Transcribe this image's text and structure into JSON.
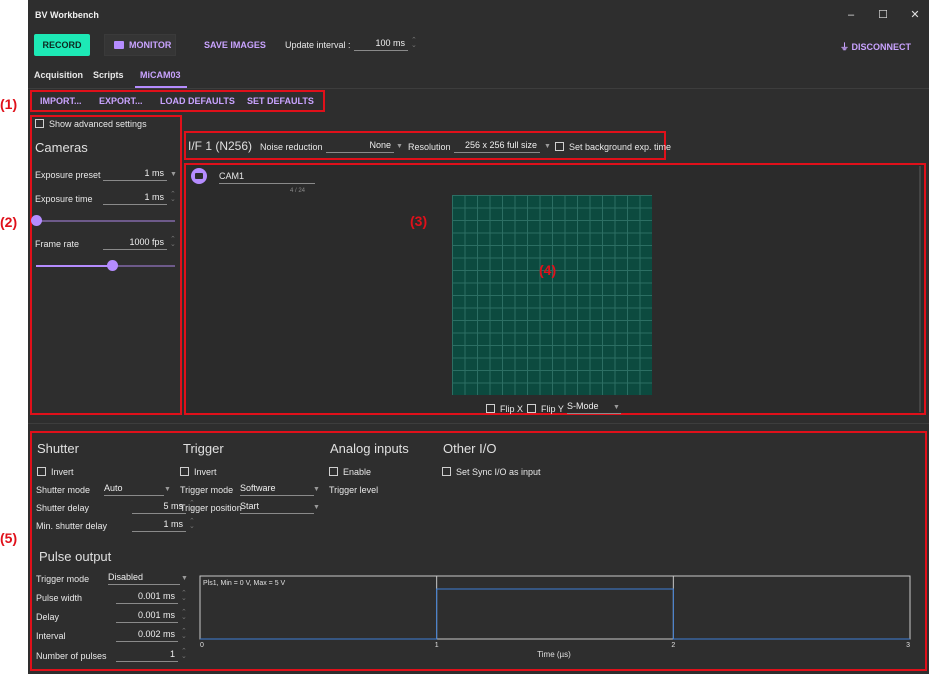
{
  "callouts": [
    "(1)",
    "(2)",
    "(3)",
    "(4)",
    "(5)"
  ],
  "title": "BV Workbench",
  "window_controls": {
    "minimize": "‒",
    "maximize": "☐",
    "close": "✕"
  },
  "toolbar": {
    "record": "RECORD",
    "monitor": "MONITOR",
    "save_images": "SAVE IMAGES",
    "update_interval_label": "Update interval :",
    "update_interval_value": "100 ms",
    "disconnect": "DISCONNECT"
  },
  "tabs": [
    "Acquisition",
    "Scripts",
    "MiCAM03"
  ],
  "actions": [
    "IMPORT...",
    "EXPORT...",
    "LOAD DEFAULTS",
    "SET DEFAULTS"
  ],
  "left": {
    "advanced": "Show advanced settings",
    "cameras_title": "Cameras",
    "exposure_preset_label": "Exposure preset",
    "exposure_preset_value": "1 ms",
    "exposure_time_label": "Exposure time",
    "exposure_time_value": "1 ms",
    "exposure_slider": 0.0,
    "frame_rate_label": "Frame rate",
    "frame_rate_value": "1000 fps",
    "frame_rate_slider": 0.55
  },
  "interface": {
    "title": "I/F 1 (N256)",
    "noise_label": "Noise reduction",
    "noise_value": "None",
    "resolution_label": "Resolution",
    "resolution_value": "256 x 256 full size",
    "bg_exp": "Set background exp. time"
  },
  "camera": {
    "name": "CAM1",
    "counter": "4 / 24",
    "flip_x": "Flip X",
    "flip_y": "Flip Y",
    "mode": "S-Mode"
  },
  "shutter": {
    "title": "Shutter",
    "invert": "Invert",
    "mode_label": "Shutter mode",
    "mode_value": "Auto",
    "delay_label": "Shutter delay",
    "delay_value": "5 ms",
    "min_label": "Min. shutter delay",
    "min_value": "1 ms"
  },
  "trigger": {
    "title": "Trigger",
    "invert": "Invert",
    "mode_label": "Trigger mode",
    "mode_value": "Software",
    "position_label": "Trigger position",
    "position_value": "Start"
  },
  "analog": {
    "title": "Analog inputs",
    "enable": "Enable",
    "level_label": "Trigger level"
  },
  "other_io": {
    "title": "Other I/O",
    "sync": "Set Sync I/O as input"
  },
  "pulse": {
    "title": "Pulse output",
    "trigger_label": "Trigger mode",
    "trigger_value": "Disabled",
    "width_label": "Pulse width",
    "width_value": "0.001 ms",
    "delay_label": "Delay",
    "delay_value": "0.001 ms",
    "interval_label": "Interval",
    "interval_value": "0.002 ms",
    "count_label": "Number of pulses",
    "count_value": "1"
  },
  "chart_data": {
    "type": "line",
    "legend": "Pls1, Min = 0 V, Max = 5 V",
    "xlabel": "Time (µs)",
    "ylabel": "",
    "xlim": [
      0,
      3
    ],
    "ylim": [
      0,
      5
    ],
    "xticks": [
      "0",
      "1",
      "2",
      "3"
    ],
    "series": [
      {
        "name": "Pls1",
        "x": [
          0,
          1,
          1,
          2,
          2,
          3
        ],
        "y": [
          0,
          0,
          5,
          5,
          0,
          0
        ]
      }
    ]
  }
}
